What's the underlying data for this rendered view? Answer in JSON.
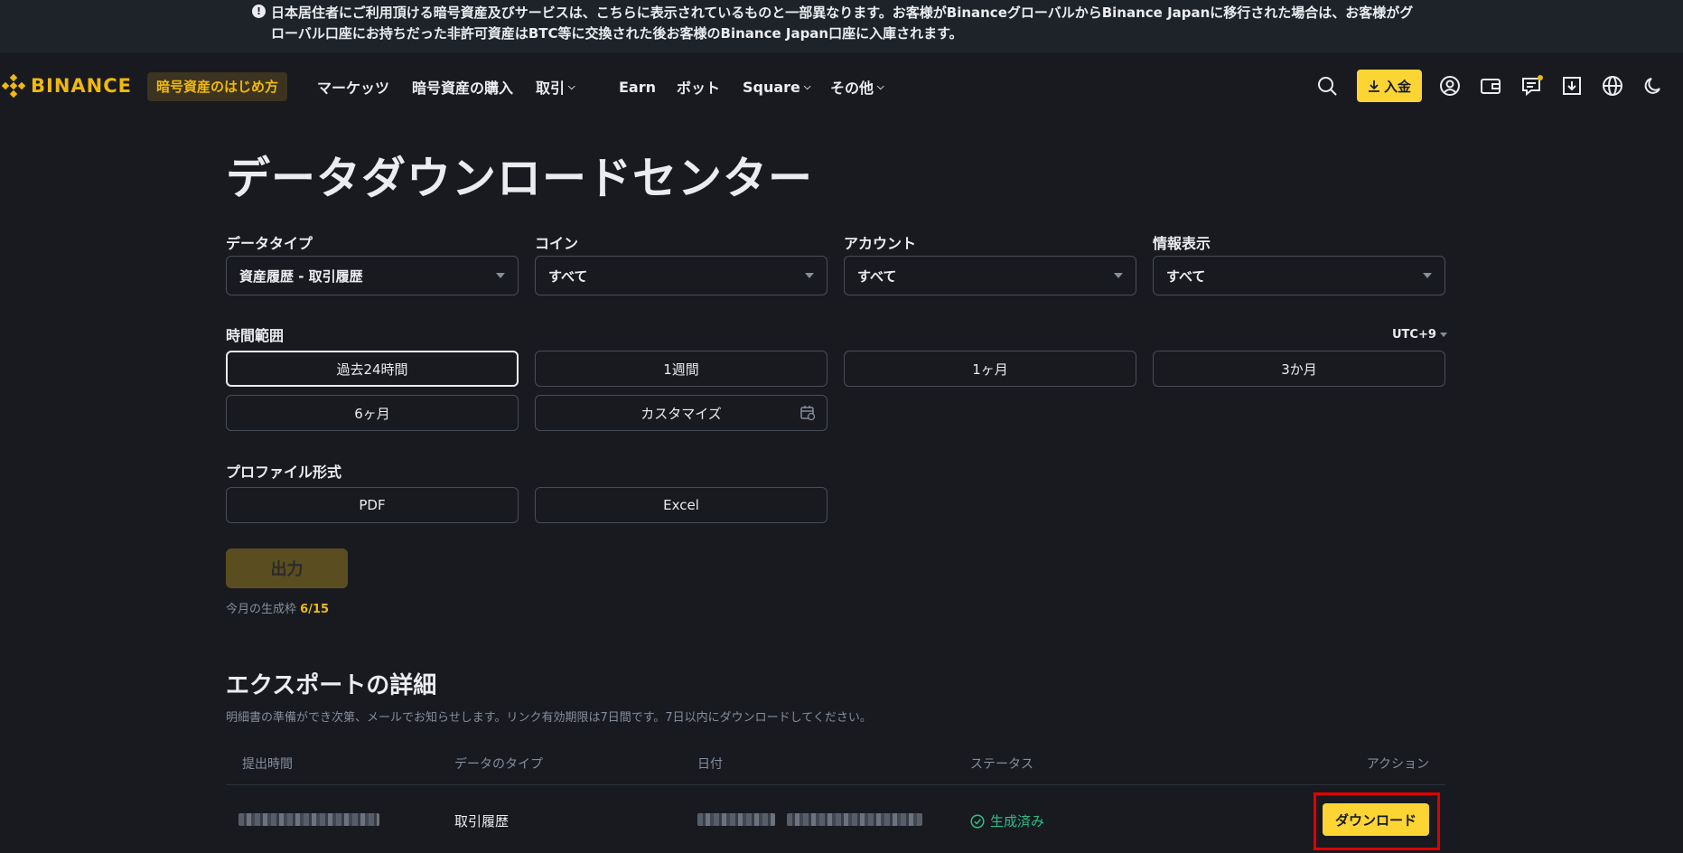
{
  "notice": {
    "text": "日本居住者にご利用頂ける暗号資産及びサービスは、こちらに表示されているものと一部異なります。お客様がBinanceグローバルからBinance Japanに移行された場合は、お客様がグローバル口座にお持ちだった非許可資産はBTC等に交換された後お客様のBinance Japan口座に入庫されます。"
  },
  "nav": {
    "logo": "BINANCE",
    "beginner": "暗号資産のはじめ方",
    "links": [
      "マーケッツ",
      "暗号資産の購入",
      "取引",
      "Earn",
      "ボット",
      "Square",
      "その他"
    ],
    "deposit": "入金"
  },
  "page": {
    "title": "データダウンロードセンター"
  },
  "filters": {
    "data_type": {
      "label": "データタイプ",
      "value": "資産履歴 - 取引履歴"
    },
    "coin": {
      "label": "コイン",
      "value": "すべて"
    },
    "account": {
      "label": "アカウント",
      "value": "すべて"
    },
    "info": {
      "label": "情報表示",
      "value": "すべて"
    }
  },
  "time_range": {
    "label": "時間範囲",
    "timezone": "UTC+9",
    "options": [
      "過去24時間",
      "1週間",
      "1ヶ月",
      "3か月",
      "6ヶ月",
      "カスタマイズ"
    ],
    "selected": "過去24時間"
  },
  "profile_format": {
    "label": "プロファイル形式",
    "options": [
      "PDF",
      "Excel"
    ]
  },
  "output": {
    "button": "出力",
    "quota_label": "今月の生成枠",
    "quota_value": "6/15"
  },
  "export": {
    "title": "エクスポートの詳細",
    "description": "明細書の準備ができ次第、メールでお知らせします。リンク有効期限は7日間です。7日以内にダウンロードしてください。",
    "columns": [
      "提出時間",
      "データのタイプ",
      "日付",
      "ステータス",
      "アクション"
    ],
    "rows": [
      {
        "data_type": "取引履歴",
        "status": "生成済み",
        "action": "ダウンロード"
      }
    ]
  },
  "colors": {
    "accent": "#fcd535",
    "brand": "#f0b90b",
    "success": "#2ebd85",
    "highlight": "#e00000"
  }
}
